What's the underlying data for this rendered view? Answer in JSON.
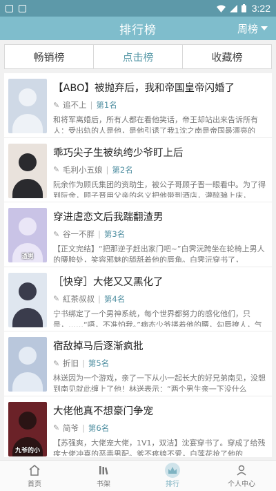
{
  "statusbar": {
    "time": "3:22"
  },
  "header": {
    "title": "排行榜",
    "filter_label": "周榜"
  },
  "tabs": [
    {
      "label": "畅销榜",
      "active": false
    },
    {
      "label": "点击榜",
      "active": true
    },
    {
      "label": "收藏榜",
      "active": false
    }
  ],
  "books": [
    {
      "title": "【ABO】被抛弃后，我和帝国皇帝闪婚了",
      "author": "追不上",
      "rank": "第1名",
      "desc": "和将军离婚后，所有人都在看他笑话，帝王却站出来告诉所有人：受出轨的人是他，是他引诱了我1沈之南是帝国最漂亮的",
      "cover_bg": "#cfd9e6",
      "cover_fg": "#eef2f7",
      "cover_text": ""
    },
    {
      "title": "乖巧尖子生被纨绔少爷盯上后",
      "author": "毛利小五娘",
      "rank": "第2名",
      "desc": "阮余作为顾氏集团的资助生，被公子哥顾子晋一眼看中。为了得到阮余，顾子晋用父亲的名义把他带到酒店，灌醉骗上床，",
      "cover_bg": "#e9e2dc",
      "cover_fg": "#2a2a2e",
      "cover_text": ""
    },
    {
      "title": "穿进虐恋文后我踹翻渣男",
      "author": "谷一不胖",
      "rank": "第3名",
      "desc": "【正文完结】“把那逆子赶出家门吧~”白霁沅跨坐在轮椅上男人的腰胯处，笑容邪魅的舔舐着他的唇角。白霁沅穿书了，",
      "cover_bg": "#c9c3e6",
      "cover_fg": "#eae6f7",
      "cover_text": "渣男"
    },
    {
      "title": "［快穿］大佬又又黑化了",
      "author": "紅茶叔叔",
      "rank": "第4名",
      "desc": "宁书绑定了一个男神系统，每个世界都努力的感化他们，只是，……“唔，不准怕我。”病态少爷搂着他的腰，勾唇撩人，气息",
      "cover_bg": "#dfe6ef",
      "cover_fg": "#3a3c4c",
      "cover_text": ""
    },
    {
      "title": "宿敌掉马后逐渐疯批",
      "author": "折旧",
      "rank": "第5名",
      "desc": "林送因为一个游戏，亲了一下从小一起长大的好兄弟南见，没想到南见就此缠上了他！林送表示：“两个男生亲一下没什么",
      "cover_bg": "#b9c7dc",
      "cover_fg": "#e4ebf4",
      "cover_text": ""
    },
    {
      "title": "大佬他真不想豪门争宠",
      "author": "简爷",
      "rank": "第6名",
      "desc": "【苏强爽，大佬宠大佬，1V1，双洁】沈宴穿书了。穿成了给残疾大佬冲喜的恶毒男配。爹不疼娘不爱，白莲花抢了他的",
      "cover_bg": "#6b2228",
      "cover_fg": "#2a1414",
      "cover_text": "九爷的小"
    }
  ],
  "nav": [
    {
      "label": "首页",
      "icon": "home-icon",
      "active": false
    },
    {
      "label": "书架",
      "icon": "bookshelf-icon",
      "active": false
    },
    {
      "label": "排行",
      "icon": "ranking-icon",
      "active": true
    },
    {
      "label": "个人中心",
      "icon": "person-icon",
      "active": false
    }
  ],
  "colors": {
    "header": "#7fbdcc",
    "statusbar": "#5d99a9",
    "accent": "#5e9dab"
  }
}
